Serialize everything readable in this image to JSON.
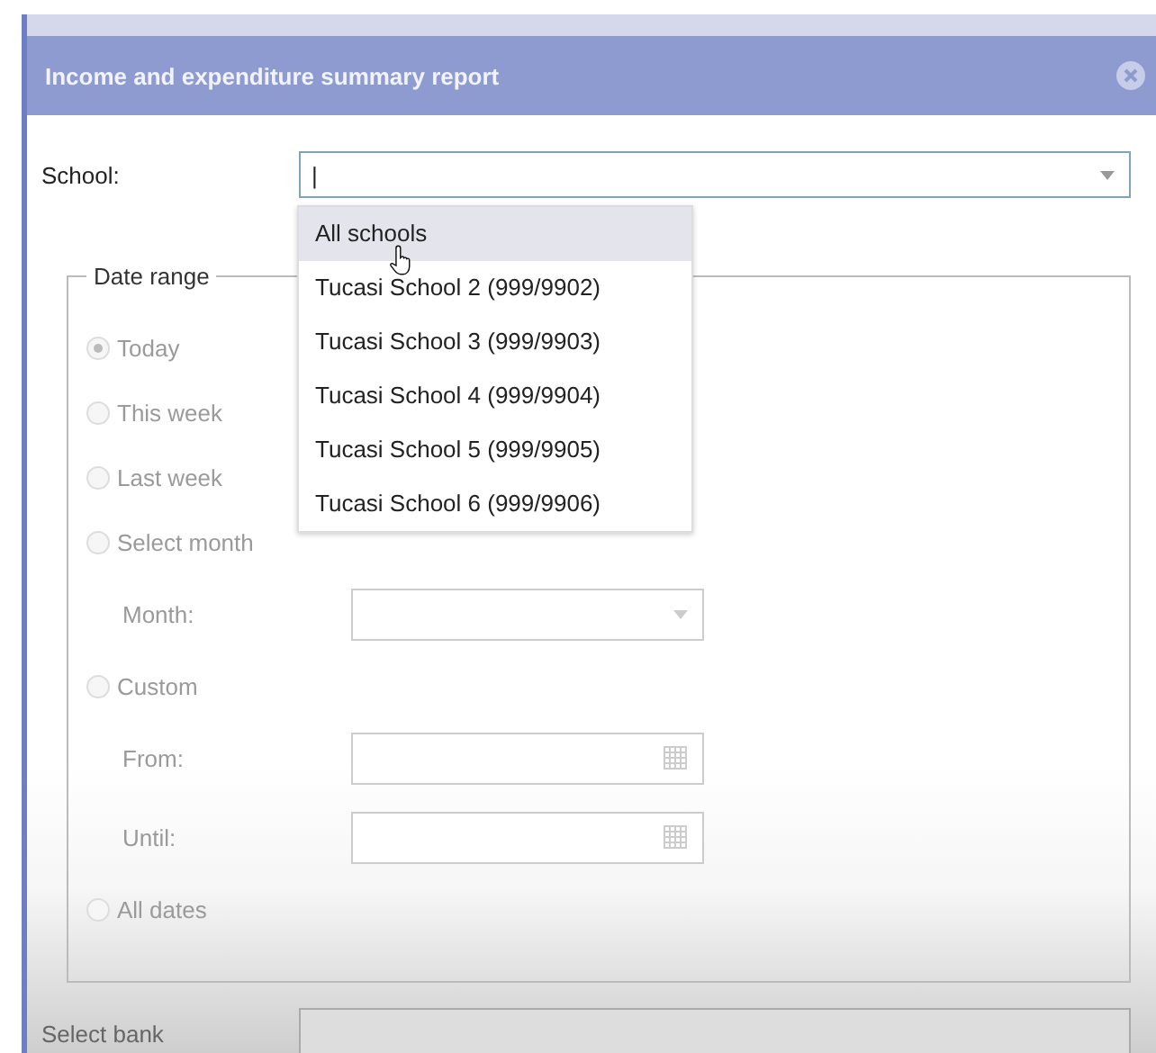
{
  "dialog": {
    "title": "Income and expenditure summary report"
  },
  "school": {
    "label": "School:",
    "value": "|",
    "open": true,
    "options": [
      {
        "label": "All schools",
        "selected": true
      },
      {
        "label": "Tucasi School 2 (999/9902)",
        "selected": false
      },
      {
        "label": "Tucasi School 3 (999/9903)",
        "selected": false
      },
      {
        "label": "Tucasi School 4 (999/9904)",
        "selected": false
      },
      {
        "label": "Tucasi School 5 (999/9905)",
        "selected": false
      },
      {
        "label": "Tucasi School 6 (999/9906)",
        "selected": false
      }
    ]
  },
  "date_range": {
    "legend": "Date range",
    "disabled": true,
    "items": [
      {
        "kind": "radio",
        "label": "Today",
        "selected": true
      },
      {
        "kind": "radio",
        "label": "This week",
        "selected": false
      },
      {
        "kind": "radio",
        "label": "Last week",
        "selected": false
      },
      {
        "kind": "radio",
        "label": "Select month",
        "selected": false
      },
      {
        "kind": "select",
        "label": "Month:"
      },
      {
        "kind": "radio",
        "label": "Custom",
        "selected": false
      },
      {
        "kind": "date",
        "label": "From:"
      },
      {
        "kind": "date",
        "label": "Until:"
      },
      {
        "kind": "radio",
        "label": "All dates",
        "selected": false
      }
    ]
  },
  "bank": {
    "label": "Select bank"
  }
}
